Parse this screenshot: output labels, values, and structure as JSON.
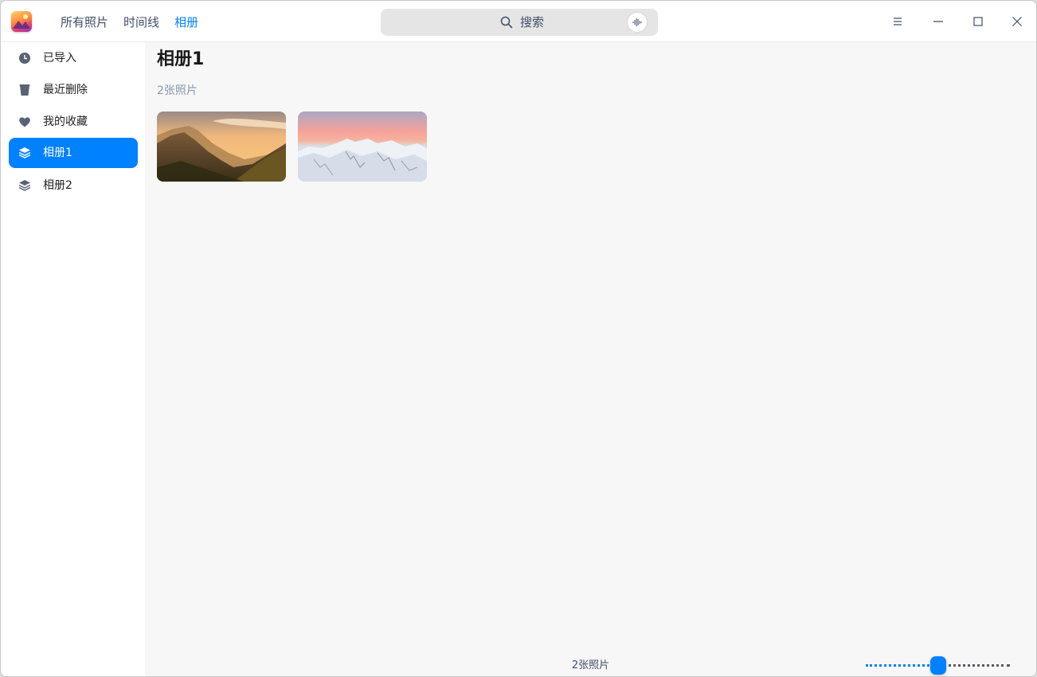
{
  "nav": {
    "tabs": [
      {
        "label": "所有照片"
      },
      {
        "label": "时间线"
      },
      {
        "label": "相册"
      }
    ],
    "active_tab": "相册"
  },
  "search": {
    "placeholder": "搜索"
  },
  "window_controls": [
    "menu-icon",
    "minimize-icon",
    "maximize-icon",
    "close-icon"
  ],
  "sidebar": {
    "items": [
      {
        "label": "已导入",
        "icon": "clock-icon"
      },
      {
        "label": "最近删除",
        "icon": "trash-icon"
      },
      {
        "label": "我的收藏",
        "icon": "heart-icon"
      },
      {
        "label": "相册1",
        "icon": "album-icon",
        "active": true
      },
      {
        "label": "相册2",
        "icon": "album-icon"
      }
    ]
  },
  "main": {
    "title": "相册1",
    "count": "2张照片",
    "photos": [
      {
        "subject": "mountain-sunset-photo"
      },
      {
        "subject": "snowy-mountain-photo"
      }
    ]
  },
  "statusbar": {
    "count": "2张照片",
    "zoom_fraction": 0.5
  },
  "colors": {
    "accent": "#0081ff",
    "sidebar_bg": "#ffffff",
    "content_bg": "#f7f7f7"
  }
}
